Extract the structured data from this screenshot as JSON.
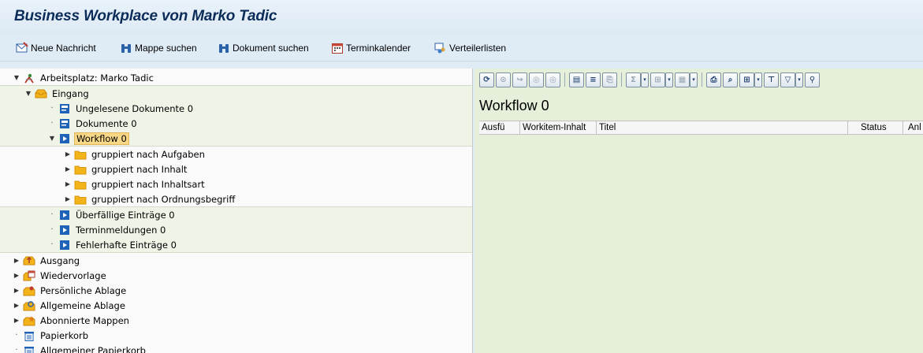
{
  "window": {
    "title": "Business Workplace von Marko Tadic"
  },
  "toolbar": {
    "new_message": "Neue Nachricht",
    "find_folder": "Mappe suchen",
    "find_document": "Dokument suchen",
    "calendar": "Terminkalender",
    "distribution_lists": "Verteilerlisten"
  },
  "tree": {
    "root": "Arbeitsplatz: Marko Tadic",
    "inbox": "Eingang",
    "unread": "Ungelesene Dokumente 0",
    "documents": "Dokumente 0",
    "workflow": "Workflow 0",
    "by_task": "gruppiert nach Aufgaben",
    "by_content": "gruppiert nach Inhalt",
    "by_content_type": "gruppiert nach Inhaltsart",
    "by_sort_key": "gruppiert nach Ordnungsbegriff",
    "overdue": "Überfällige Einträge 0",
    "deadline": "Terminmeldungen 0",
    "errors": "Fehlerhafte Einträge 0",
    "outbox": "Ausgang",
    "resubmission": "Wiedervorlage",
    "private_folders": "Persönliche Ablage",
    "shared_folders": "Allgemeine Ablage",
    "subscribed": "Abonnierte Mappen",
    "trash": "Papierkorb",
    "shared_trash": "Allgemeiner Papierkorb"
  },
  "content": {
    "heading": "Workflow 0",
    "columns": [
      "Ausfü",
      "Workitem-Inhalt",
      "Titel",
      "Status",
      "Anl"
    ]
  },
  "colors": {
    "title": "#0b2c59",
    "tree_band": "#eef4e6",
    "selection": "#f8d887",
    "right_pane": "#e5efd9",
    "workflow_icon": "#1f63b8",
    "folder": "#f2b418"
  },
  "icons": [
    "new-message-icon",
    "binoculars-icon",
    "calendar-icon",
    "distribution-list-icon",
    "workplace-icon",
    "inbox-icon",
    "document-icon",
    "workflow-icon",
    "folder-icon",
    "outbox-icon",
    "resubmission-icon",
    "private-folder-icon",
    "shared-folder-icon",
    "subscribed-folder-icon",
    "trash-icon"
  ]
}
